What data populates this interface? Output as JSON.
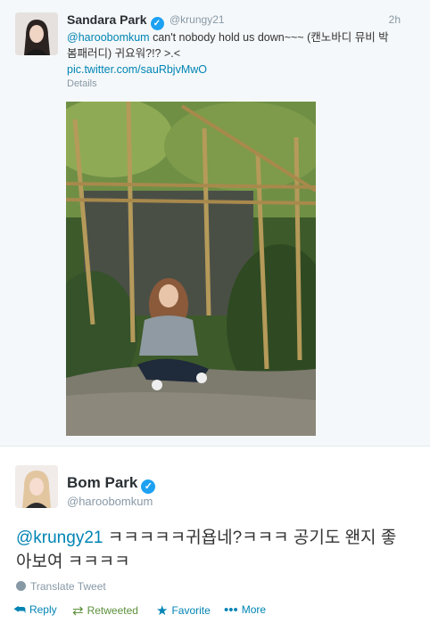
{
  "tweet1": {
    "name": "Sandara Park",
    "handle": "@krungy21",
    "time": "2h",
    "mention": "@haroobomkum",
    "text": " can't nobody hold us down~~~ (캔노바디 뮤비 박봄패러디) 귀요워?!? >.<",
    "link": "pic.twitter.com/sauRbjvMwO",
    "details": "Details"
  },
  "tweet2": {
    "name": "Bom Park",
    "handle": "@haroobomkum",
    "mention": "@krungy21",
    "text": " ㅋㅋㅋㅋㅋ귀욥네?ㅋㅋㅋ 공기도 왠지 좋아보여 ㅋㅋㅋㅋ",
    "translate": "Translate Tweet"
  },
  "actions": {
    "reply": "Reply",
    "retweeted": "Retweeted",
    "favorite": "Favorite",
    "more": "More"
  },
  "colors": {
    "link": "#0084b4",
    "verified": "#1da1f2",
    "retweet": "#5c913b"
  }
}
